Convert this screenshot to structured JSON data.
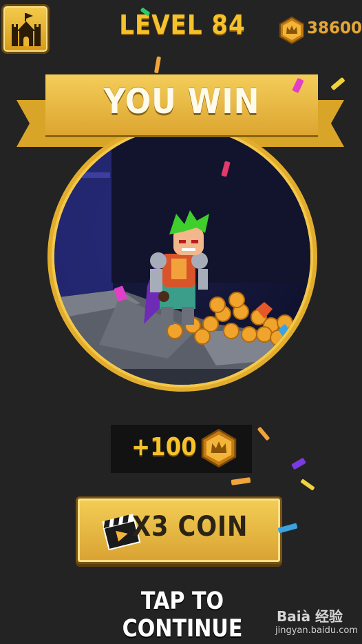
{
  "level_label": "LEVEL 84",
  "coin_total": "38600",
  "banner_title": "YOU WIN",
  "reward_amount": "+100",
  "multiplier_button_label": "X3 COIN",
  "continue_label": "TAP TO CONTINUE",
  "watermark": {
    "brand": "Baià 经验",
    "url": "jingyan.baidu.com"
  },
  "icons": {
    "home": "castle-icon",
    "coin": "crown-coin-icon",
    "video": "clapperboard-icon"
  },
  "colors": {
    "background": "#232323",
    "gold": "#f6c22b",
    "button_gold": "#e2b23d"
  }
}
